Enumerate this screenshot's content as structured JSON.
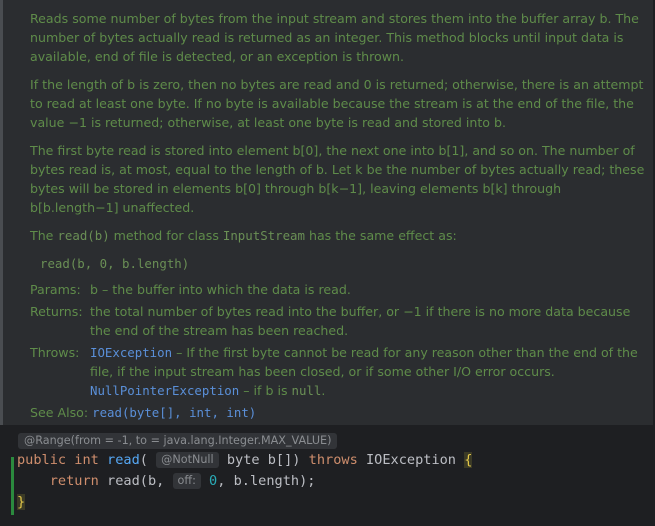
{
  "doc": {
    "p1": "Reads some number of bytes from the input stream and stores them into the buffer array b. The number of bytes actually read is returned as an integer. This method blocks until input data is available, end of file is detected, or an exception is thrown.",
    "p2": "If the length of b is zero, then no bytes are read and 0 is returned; otherwise, there is an attempt to read at least one byte. If no byte is available because the stream is at the end of the file, the value −1 is returned; otherwise, at least one byte is read and stored into b.",
    "p3": "The first byte read is stored into element b[0], the next one into b[1], and so on. The number of bytes read is, at most, equal to the length of b. Let k be the number of bytes actually read; these bytes will be stored in elements b[0] through b[k−1], leaving elements b[k] through b[b.length−1] unaffected.",
    "p4_prefix": "The ",
    "p4_code1": "read(b)",
    "p4_mid": " method for class ",
    "p4_code2": "InputStream",
    "p4_suffix": " has the same effect as:",
    "example_code": "read(b, 0, b.length)",
    "params_label": "Params:",
    "params_value": "b – the buffer into which the data is read.",
    "returns_label": "Returns:",
    "returns_value": "the total number of bytes read into the buffer, or −1 if there is no more data because the end of the stream has been reached.",
    "throws_label": "Throws:",
    "throws_ex1": "IOException",
    "throws_ex1_desc": " – If the first byte cannot be read for any reason other than the end of the file, if the input stream has been closed, or if some other I/O error occurs.",
    "throws_ex2": "NullPointerException",
    "throws_ex2_desc_pre": " – if b is ",
    "throws_ex2_null": "null",
    "throws_ex2_desc_post": ".",
    "see_also_label": "See Also:",
    "see_also_link": "read(byte[], int, int)"
  },
  "code": {
    "range_hint": "@Range(from = -1, to = java.lang.Integer.MAX_VALUE)",
    "kw_public": "public",
    "kw_int": "int",
    "method_name": "read",
    "paren_open": "( ",
    "notnull_hint": "@NotNull",
    "param_decl": " byte b[]) ",
    "kw_throws": "throws",
    "exception": " IOException ",
    "brace_open": "{",
    "kw_return": "return",
    "call": " read(b, ",
    "off_hint": "off:",
    "zero": "0",
    "call_rest": ", b.length);",
    "brace_close": "}"
  }
}
